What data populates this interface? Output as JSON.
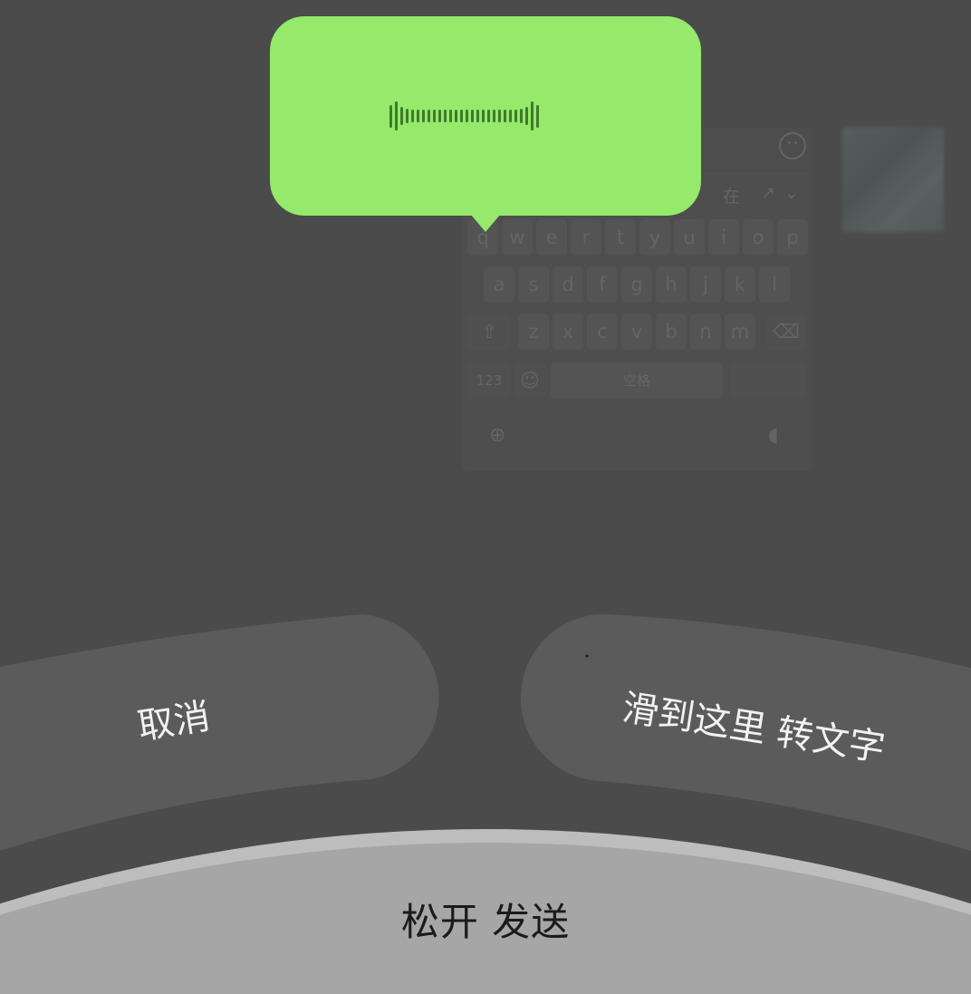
{
  "voice_overlay": {
    "bubble_color": "#95e96b",
    "waveform_color": "#3f7a2c",
    "waveform_levels": [
      0.7,
      0.9,
      0.55,
      0.45,
      0.4,
      0.4,
      0.4,
      0.4,
      0.4,
      0.4,
      0.4,
      0.4,
      0.4,
      0.4,
      0.4,
      0.4,
      0.4,
      0.4,
      0.4,
      0.4,
      0.4,
      0.4,
      0.4,
      0.4,
      0.45,
      0.55,
      0.9,
      0.7
    ]
  },
  "actions": {
    "cancel_label": "取消",
    "convert_label": "滑到这里 转文字",
    "send_label": "松开 发送"
  },
  "keyboard_background": {
    "candidate_word": "在",
    "row1": [
      "q",
      "w",
      "e",
      "r",
      "t",
      "y",
      "u",
      "i",
      "o",
      "p"
    ],
    "row2": [
      "a",
      "s",
      "d",
      "f",
      "g",
      "h",
      "j",
      "k",
      "l"
    ],
    "row3": [
      "z",
      "x",
      "c",
      "v",
      "b",
      "n",
      "m"
    ],
    "numbers_key": "123",
    "space_key": "空格"
  },
  "colors": {
    "background": "#4b4b4b",
    "pill": "#5b5b5b",
    "send_arc": "#a6a6a6",
    "send_arc_edge": "#bdbdbd"
  }
}
